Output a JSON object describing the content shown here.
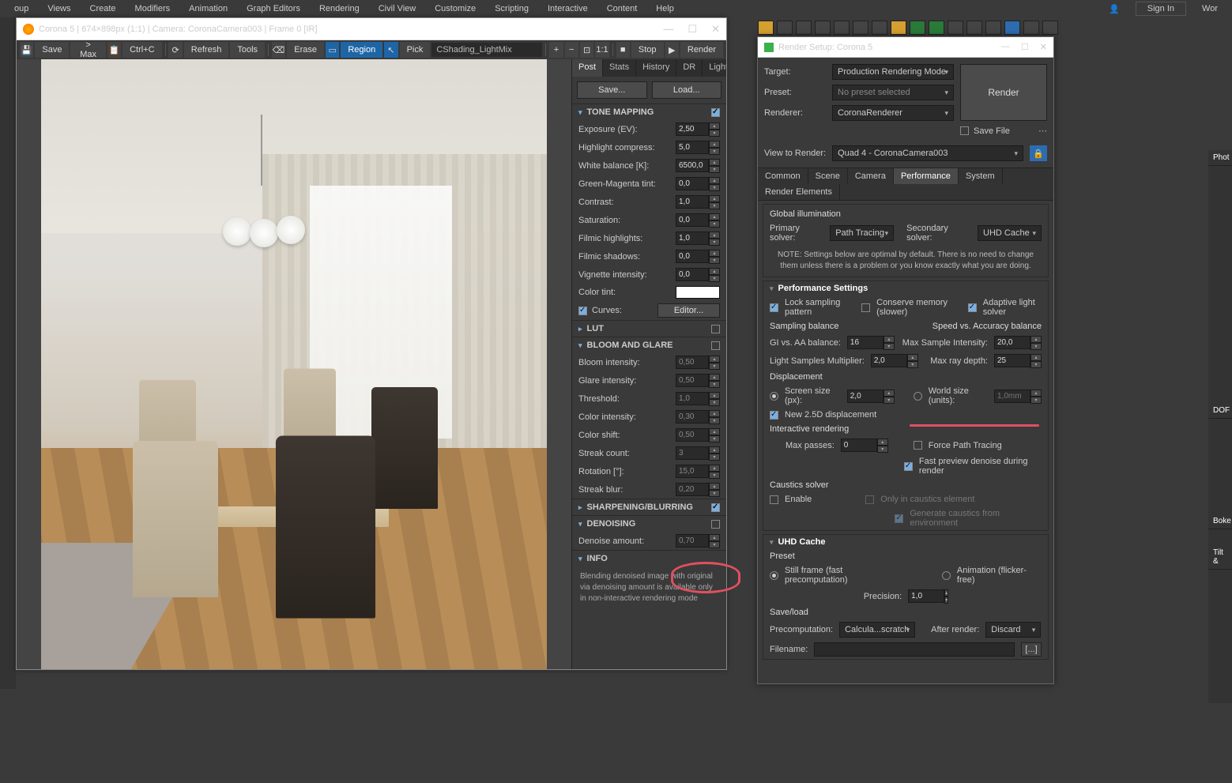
{
  "menubar": {
    "items": [
      "oup",
      "Views",
      "Create",
      "Modifiers",
      "Animation",
      "Graph Editors",
      "Rendering",
      "Civil View",
      "Customize",
      "Scripting",
      "Interactive",
      "Content",
      "Help"
    ],
    "signin": "Sign In",
    "wor": "Wor"
  },
  "vfb": {
    "title": "Corona 5 | 674×898px (1:1) | Camera: CoronaCamera003 | Frame 0 [IR]",
    "toolbar": {
      "save": "Save",
      "tomax": "> Max",
      "ctrlc": "Ctrl+C",
      "refresh": "Refresh",
      "tools": "Tools",
      "erase": "Erase",
      "region": "Region",
      "pick": "Pick",
      "channel": "CShading_LightMix",
      "stop": "Stop",
      "render": "Render"
    },
    "tabs": [
      "Post",
      "Stats",
      "History",
      "DR",
      "LightMix"
    ],
    "btns": {
      "save": "Save...",
      "load": "Load..."
    },
    "sections": {
      "tone": "TONE MAPPING",
      "lut": "LUT",
      "bloom": "BLOOM AND GLARE",
      "sharp": "SHARPENING/BLURRING",
      "denoise": "DENOISING",
      "info": "INFO"
    },
    "tone": {
      "exposure_l": "Exposure (EV):",
      "exposure": "2,50",
      "highlight_l": "Highlight compress:",
      "highlight": "5,0",
      "wb_l": "White balance [K]:",
      "wb": "6500,0",
      "gm_l": "Green-Magenta tint:",
      "gm": "0,0",
      "contrast_l": "Contrast:",
      "contrast": "1,0",
      "sat_l": "Saturation:",
      "sat": "0,0",
      "fh_l": "Filmic highlights:",
      "fh": "1,0",
      "fs_l": "Filmic shadows:",
      "fs": "0,0",
      "vig_l": "Vignette intensity:",
      "vig": "0,0",
      "tint_l": "Color tint:",
      "curves_l": "Curves:",
      "editor": "Editor..."
    },
    "bloom": {
      "bi_l": "Bloom intensity:",
      "bi": "0,50",
      "gi_l": "Glare intensity:",
      "gi": "0,50",
      "th_l": "Threshold:",
      "th": "1,0",
      "ci_l": "Color intensity:",
      "ci": "0,30",
      "cs_l": "Color shift:",
      "cs": "0,50",
      "sc_l": "Streak count:",
      "sc": "3",
      "rot_l": "Rotation [°]:",
      "rot": "15,0",
      "sb_l": "Streak blur:",
      "sb": "0,20"
    },
    "denoise": {
      "amount_l": "Denoise amount:",
      "amount": "0,70"
    },
    "info_text": "Blending denoised image with original via denoising amount is available only in non-interactive rendering mode"
  },
  "rs": {
    "title": "Render Setup: Corona 5",
    "target_l": "Target:",
    "target": "Production Rendering Mode",
    "preset_l": "Preset:",
    "preset": "No preset selected",
    "renderer_l": "Renderer:",
    "renderer": "CoronaRenderer",
    "render_btn": "Render",
    "savefile": "Save File",
    "view_l": "View to Render:",
    "view": "Quad 4 - CoronaCamera003",
    "tabs": [
      "Common",
      "Scene",
      "Camera",
      "Performance",
      "System",
      "Render Elements"
    ],
    "gi": {
      "title": "Global illumination",
      "primary_l": "Primary solver:",
      "primary": "Path Tracing",
      "secondary_l": "Secondary solver:",
      "secondary": "UHD Cache",
      "note": "NOTE: Settings below are optimal by default. There is no need to change them unless there is a problem or you know exactly what you are doing."
    },
    "perf": {
      "title": "Performance Settings",
      "lock": "Lock sampling pattern",
      "conserve": "Conserve memory (slower)",
      "adaptive": "Adaptive light solver",
      "sb": "Sampling balance",
      "giaa_l": "GI vs. AA balance:",
      "giaa": "16",
      "lsm_l": "Light Samples Multiplier:",
      "lsm": "2,0",
      "svb": "Speed vs. Accuracy balance",
      "msi_l": "Max Sample Intensity:",
      "msi": "20,0",
      "mrd_l": "Max ray depth:",
      "mrd": "25",
      "disp": "Displacement",
      "screen_l": "Screen size (px):",
      "screen": "2,0",
      "world_l": "World size (units):",
      "world": "1,0mm",
      "new25": "New 2.5D displacement",
      "inter": "Interactive rendering",
      "maxp_l": "Max passes:",
      "maxp": "0",
      "force": "Force Path Tracing",
      "fast": "Fast preview denoise during render",
      "caustics": "Caustics solver",
      "enable": "Enable",
      "only": "Only in caustics element",
      "gen": "Generate caustics from environment"
    },
    "uhd": {
      "title": "UHD Cache",
      "preset": "Preset",
      "still": "Still frame (fast precomputation)",
      "anim": "Animation (flicker-free)",
      "prec_l": "Precision:",
      "prec": "1,0",
      "save": "Save/load",
      "precomp_l": "Precomputation:",
      "precomp": "Calcula...scratch",
      "after_l": "After render:",
      "after": "Discard",
      "file_l": "Filename:"
    }
  },
  "right_sections": [
    "Phot",
    "DOF",
    "Boke",
    "Tilt &"
  ]
}
